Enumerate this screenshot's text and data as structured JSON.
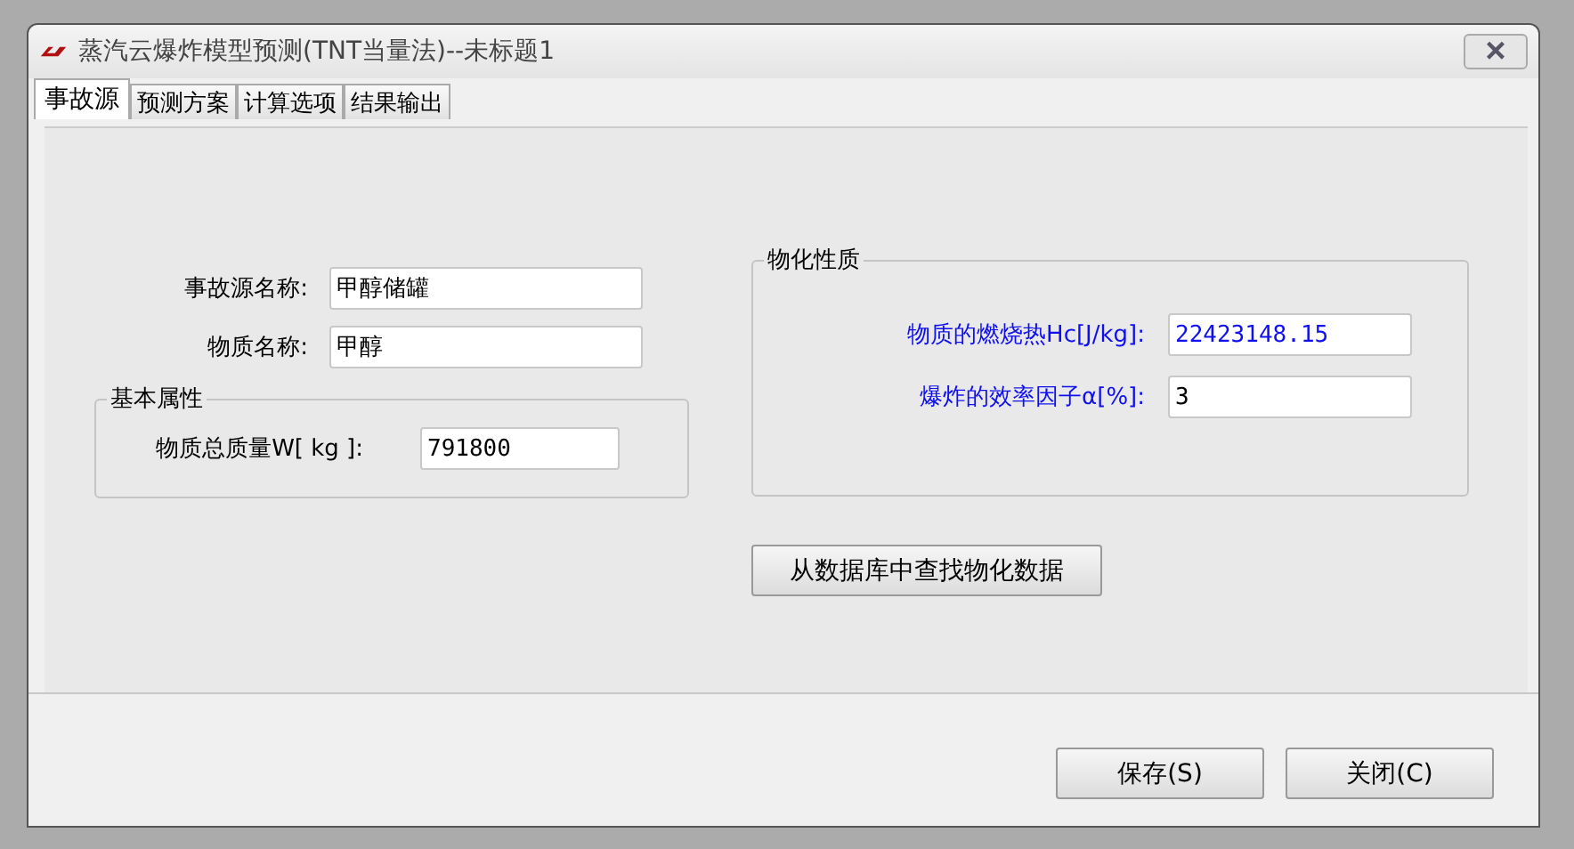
{
  "window": {
    "title": "蒸汽云爆炸模型预测(TNT当量法)--未标题1",
    "close_button": "×"
  },
  "tabs": [
    {
      "label": "事故源",
      "selected": true
    },
    {
      "label": "预测方案",
      "selected": false
    },
    {
      "label": "计算选项",
      "selected": false
    },
    {
      "label": "结果输出",
      "selected": false
    }
  ],
  "source_fields": [
    {
      "label": "事故源名称:",
      "value": "甲醇储罐"
    },
    {
      "label": "物质名称:",
      "value": "甲醇"
    }
  ],
  "basic_properties": {
    "title": "基本属性",
    "fields": [
      {
        "label": "物质总质量W[ kg ]:",
        "value": "791800"
      }
    ]
  },
  "physicochemical_properties": {
    "title": "物化性质",
    "fields": [
      {
        "label": "物质的燃烧热Hc[J/kg]:",
        "value": "22423148.15"
      },
      {
        "label": "爆炸的效率因子α[%]:",
        "value": "3"
      }
    ]
  },
  "lookup_button": "从数据库中查找物化数据",
  "buttons": [
    "保存(S)",
    "关闭(C)"
  ]
}
